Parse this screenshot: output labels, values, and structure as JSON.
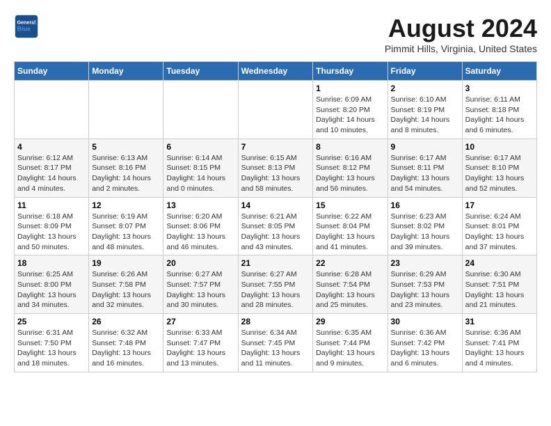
{
  "header": {
    "logo_line1": "General",
    "logo_line2": "Blue",
    "month_year": "August 2024",
    "location": "Pimmit Hills, Virginia, United States"
  },
  "days_of_week": [
    "Sunday",
    "Monday",
    "Tuesday",
    "Wednesday",
    "Thursday",
    "Friday",
    "Saturday"
  ],
  "weeks": [
    [
      {
        "day": "",
        "info": ""
      },
      {
        "day": "",
        "info": ""
      },
      {
        "day": "",
        "info": ""
      },
      {
        "day": "",
        "info": ""
      },
      {
        "day": "1",
        "info": "Sunrise: 6:09 AM\nSunset: 8:20 PM\nDaylight: 14 hours\nand 10 minutes."
      },
      {
        "day": "2",
        "info": "Sunrise: 6:10 AM\nSunset: 8:19 PM\nDaylight: 14 hours\nand 8 minutes."
      },
      {
        "day": "3",
        "info": "Sunrise: 6:11 AM\nSunset: 8:18 PM\nDaylight: 14 hours\nand 6 minutes."
      }
    ],
    [
      {
        "day": "4",
        "info": "Sunrise: 6:12 AM\nSunset: 8:17 PM\nDaylight: 14 hours\nand 4 minutes."
      },
      {
        "day": "5",
        "info": "Sunrise: 6:13 AM\nSunset: 8:16 PM\nDaylight: 14 hours\nand 2 minutes."
      },
      {
        "day": "6",
        "info": "Sunrise: 6:14 AM\nSunset: 8:15 PM\nDaylight: 14 hours\nand 0 minutes."
      },
      {
        "day": "7",
        "info": "Sunrise: 6:15 AM\nSunset: 8:13 PM\nDaylight: 13 hours\nand 58 minutes."
      },
      {
        "day": "8",
        "info": "Sunrise: 6:16 AM\nSunset: 8:12 PM\nDaylight: 13 hours\nand 56 minutes."
      },
      {
        "day": "9",
        "info": "Sunrise: 6:17 AM\nSunset: 8:11 PM\nDaylight: 13 hours\nand 54 minutes."
      },
      {
        "day": "10",
        "info": "Sunrise: 6:17 AM\nSunset: 8:10 PM\nDaylight: 13 hours\nand 52 minutes."
      }
    ],
    [
      {
        "day": "11",
        "info": "Sunrise: 6:18 AM\nSunset: 8:09 PM\nDaylight: 13 hours\nand 50 minutes."
      },
      {
        "day": "12",
        "info": "Sunrise: 6:19 AM\nSunset: 8:07 PM\nDaylight: 13 hours\nand 48 minutes."
      },
      {
        "day": "13",
        "info": "Sunrise: 6:20 AM\nSunset: 8:06 PM\nDaylight: 13 hours\nand 46 minutes."
      },
      {
        "day": "14",
        "info": "Sunrise: 6:21 AM\nSunset: 8:05 PM\nDaylight: 13 hours\nand 43 minutes."
      },
      {
        "day": "15",
        "info": "Sunrise: 6:22 AM\nSunset: 8:04 PM\nDaylight: 13 hours\nand 41 minutes."
      },
      {
        "day": "16",
        "info": "Sunrise: 6:23 AM\nSunset: 8:02 PM\nDaylight: 13 hours\nand 39 minutes."
      },
      {
        "day": "17",
        "info": "Sunrise: 6:24 AM\nSunset: 8:01 PM\nDaylight: 13 hours\nand 37 minutes."
      }
    ],
    [
      {
        "day": "18",
        "info": "Sunrise: 6:25 AM\nSunset: 8:00 PM\nDaylight: 13 hours\nand 34 minutes."
      },
      {
        "day": "19",
        "info": "Sunrise: 6:26 AM\nSunset: 7:58 PM\nDaylight: 13 hours\nand 32 minutes."
      },
      {
        "day": "20",
        "info": "Sunrise: 6:27 AM\nSunset: 7:57 PM\nDaylight: 13 hours\nand 30 minutes."
      },
      {
        "day": "21",
        "info": "Sunrise: 6:27 AM\nSunset: 7:55 PM\nDaylight: 13 hours\nand 28 minutes."
      },
      {
        "day": "22",
        "info": "Sunrise: 6:28 AM\nSunset: 7:54 PM\nDaylight: 13 hours\nand 25 minutes."
      },
      {
        "day": "23",
        "info": "Sunrise: 6:29 AM\nSunset: 7:53 PM\nDaylight: 13 hours\nand 23 minutes."
      },
      {
        "day": "24",
        "info": "Sunrise: 6:30 AM\nSunset: 7:51 PM\nDaylight: 13 hours\nand 21 minutes."
      }
    ],
    [
      {
        "day": "25",
        "info": "Sunrise: 6:31 AM\nSunset: 7:50 PM\nDaylight: 13 hours\nand 18 minutes."
      },
      {
        "day": "26",
        "info": "Sunrise: 6:32 AM\nSunset: 7:48 PM\nDaylight: 13 hours\nand 16 minutes."
      },
      {
        "day": "27",
        "info": "Sunrise: 6:33 AM\nSunset: 7:47 PM\nDaylight: 13 hours\nand 13 minutes."
      },
      {
        "day": "28",
        "info": "Sunrise: 6:34 AM\nSunset: 7:45 PM\nDaylight: 13 hours\nand 11 minutes."
      },
      {
        "day": "29",
        "info": "Sunrise: 6:35 AM\nSunset: 7:44 PM\nDaylight: 13 hours\nand 9 minutes."
      },
      {
        "day": "30",
        "info": "Sunrise: 6:36 AM\nSunset: 7:42 PM\nDaylight: 13 hours\nand 6 minutes."
      },
      {
        "day": "31",
        "info": "Sunrise: 6:36 AM\nSunset: 7:41 PM\nDaylight: 13 hours\nand 4 minutes."
      }
    ]
  ]
}
